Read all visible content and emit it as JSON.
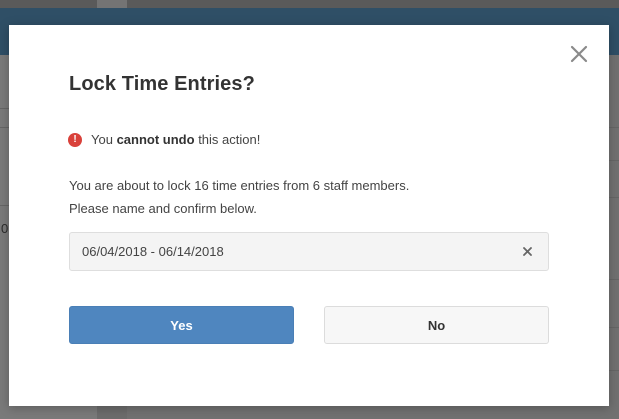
{
  "dialog": {
    "title": "Lock Time Entries?",
    "warning": {
      "icon": "exclamation-circle-icon",
      "prefix": "You",
      "emphasis": "cannot undo",
      "suffix": "this action!",
      "icon_color": "#d9413a"
    },
    "description_line1": "You are about to lock 16 time entries from 6 staff members.",
    "description_line2": "Please name and confirm below.",
    "date_range_value": "06/04/2018 - 06/14/2018",
    "yes_label": "Yes",
    "no_label": "No",
    "accent_color": "#4f86bf"
  },
  "background": {
    "edge_text": "0"
  }
}
